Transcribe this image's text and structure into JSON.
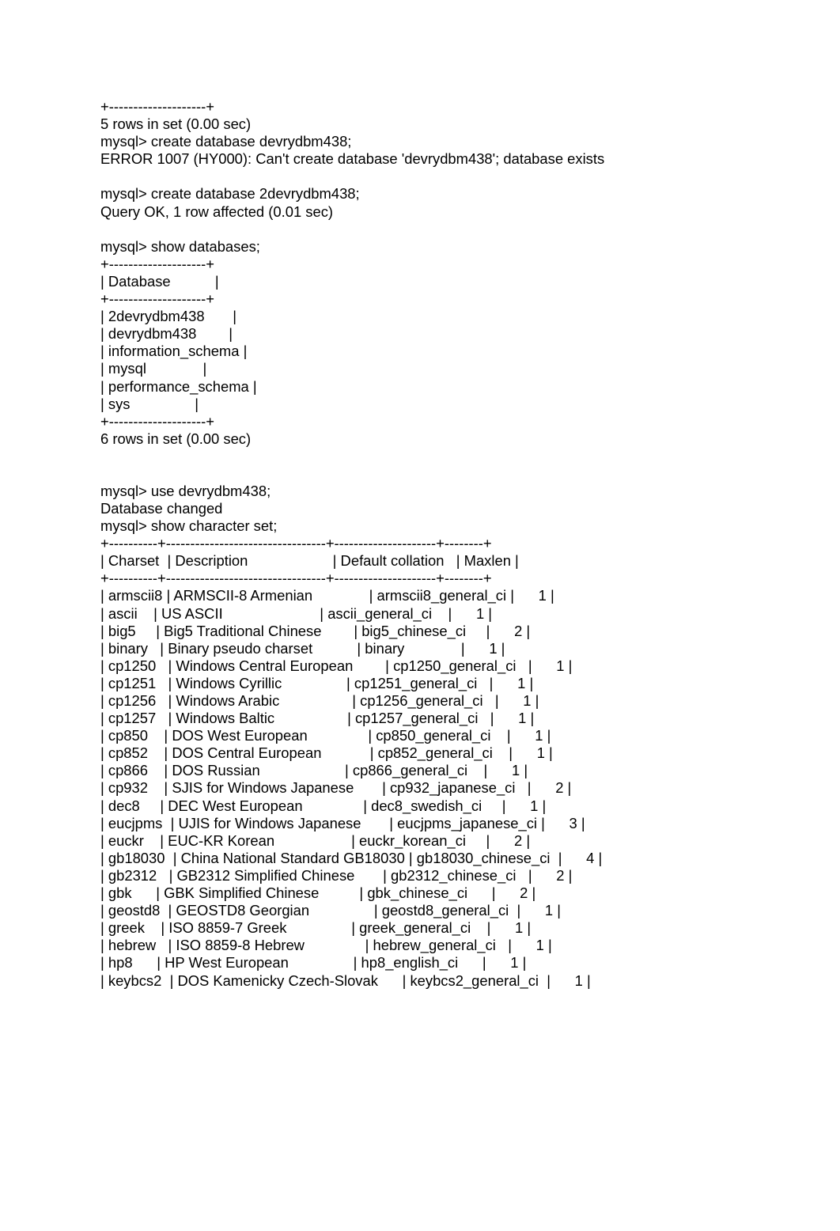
{
  "document": {
    "block1": {
      "border_top": "+--------------------+",
      "rows_summary": "5 rows in set (0.00 sec)"
    },
    "cmd_create_1": "mysql> create database devrydbm438;",
    "error_line": "ERROR 1007 (HY000): Can't create database 'devrydbm438'; database exists",
    "cmd_create_2": "mysql> create database 2devrydbm438;",
    "query_ok": "Query OK, 1 row affected (0.01 sec)",
    "cmd_show_databases": "mysql> show databases;",
    "databases_table": {
      "border": "+--------------------+",
      "header": "| Database           |",
      "rows": [
        "| 2devrydbm438       |",
        "| devrydbm438        |",
        "| information_schema |",
        "| mysql              |",
        "| performance_schema |",
        "| sys                |"
      ],
      "summary": "6 rows in set (0.00 sec)"
    },
    "cmd_use": "mysql> use devrydbm438;",
    "db_changed": "Database changed",
    "cmd_show_charset": "mysql> show character set;",
    "charset_table": {
      "border": "+----------+---------------------------------+---------------------+--------+",
      "header": "| Charset  | Description                     | Default collation   | Maxlen |",
      "rows": [
        "| armscii8 | ARMSCII-8 Armenian              | armscii8_general_ci |      1 |",
        "| ascii    | US ASCII                        | ascii_general_ci    |      1 |",
        "| big5     | Big5 Traditional Chinese        | big5_chinese_ci     |      2 |",
        "| binary   | Binary pseudo charset           | binary              |      1 |",
        "| cp1250   | Windows Central European        | cp1250_general_ci   |      1 |",
        "| cp1251   | Windows Cyrillic                | cp1251_general_ci   |      1 |",
        "| cp1256   | Windows Arabic                  | cp1256_general_ci   |      1 |",
        "| cp1257   | Windows Baltic                  | cp1257_general_ci   |      1 |",
        "| cp850    | DOS West European               | cp850_general_ci    |      1 |",
        "| cp852    | DOS Central European            | cp852_general_ci    |      1 |",
        "| cp866    | DOS Russian                     | cp866_general_ci    |      1 |",
        "| cp932    | SJIS for Windows Japanese       | cp932_japanese_ci   |      2 |",
        "| dec8     | DEC West European               | dec8_swedish_ci     |      1 |",
        "| eucjpms  | UJIS for Windows Japanese       | eucjpms_japanese_ci |      3 |",
        "| euckr    | EUC-KR Korean                   | euckr_korean_ci     |      2 |",
        "| gb18030  | China National Standard GB18030 | gb18030_chinese_ci  |      4 |",
        "| gb2312   | GB2312 Simplified Chinese       | gb2312_chinese_ci   |      2 |",
        "| gbk      | GBK Simplified Chinese          | gbk_chinese_ci      |      2 |",
        "| geostd8  | GEOSTD8 Georgian                | geostd8_general_ci  |      1 |",
        "| greek    | ISO 8859-7 Greek                | greek_general_ci    |      1 |",
        "| hebrew   | ISO 8859-8 Hebrew               | hebrew_general_ci   |      1 |",
        "| hp8      | HP West European                | hp8_english_ci      |      1 |",
        "| keybcs2  | DOS Kamenicky Czech-Slovak      | keybcs2_general_ci  |      1 |"
      ]
    }
  }
}
